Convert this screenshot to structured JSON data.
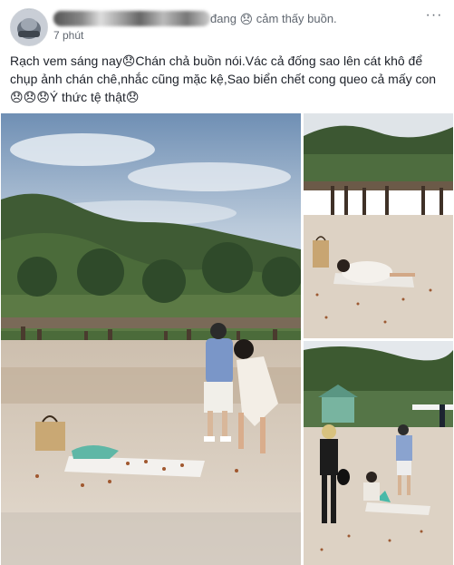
{
  "header": {
    "feeling_text": "đang",
    "feeling_emoji": "😞",
    "feeling_label": "cảm thấy buồn.",
    "timestamp": "7 phút",
    "more_label": "···"
  },
  "post": {
    "text_line_1a": "Rạch vem sáng nay",
    "emoji_1": "😞",
    "text_line_1b": "Chán chả buồn nói.Vác cả đống sao lên cát khô để chụp ảnh chán chê,nhắc cũng mặc kệ,Sao biển chết cong queo cả mấy con",
    "emoji_row": "😞😞😞",
    "text_line_end": "Ý thức tệ thật",
    "emoji_end": "😞"
  },
  "photos": {
    "count": 3,
    "accent_sand": "#d9cdbd",
    "accent_sky": "#a9c0d9",
    "accent_forest": "#3d5a32"
  }
}
